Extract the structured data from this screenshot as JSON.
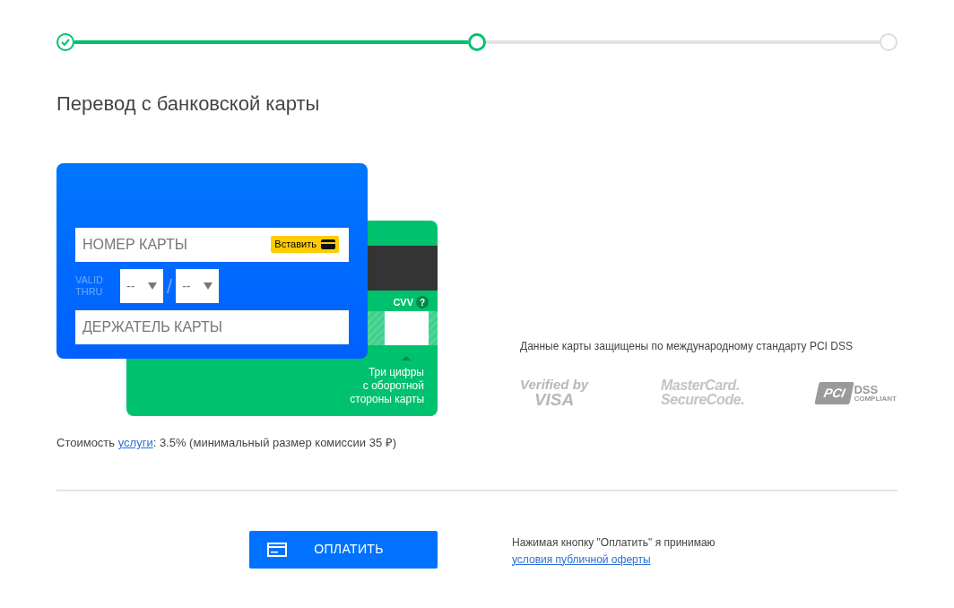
{
  "steps": [
    {
      "done": true,
      "selected": false
    },
    {
      "done": false,
      "selected": true
    },
    {
      "done": false,
      "selected": false
    }
  ],
  "title": "Перевод с банковской карты",
  "card_front": {
    "number_placeholder": "НОМЕР КАРТЫ",
    "paste_button": "Вставить",
    "valid_thru": "VALID THRU",
    "month": "--",
    "separator": "/",
    "year": "--",
    "holder_placeholder": "ДЕРЖАТЕЛЬ КАРТЫ"
  },
  "card_back": {
    "cvv_label": "CVV",
    "help": "?",
    "hint_lines": [
      "Три цифры",
      "с оборотной",
      "стороны карты"
    ]
  },
  "fee": {
    "before": "Стоимость ",
    "link": "услуги",
    "after": ": 3.5% (минимальный размер комиссии 35 ₽)"
  },
  "security": {
    "note": "Данные карты защищены по международному стандарту PCI DSS",
    "logos": [
      {
        "kind": "visa",
        "lines": [
          "Verified by",
          "VISA"
        ]
      },
      {
        "kind": "mastercard",
        "lines": [
          "MasterCard.",
          "SecureCode."
        ]
      },
      {
        "kind": "pci",
        "lines": [
          "PCI",
          "DSS",
          "COMPLIANT"
        ]
      }
    ]
  },
  "pay_button": "ОПЛАТИТЬ",
  "terms": {
    "text": "Нажимая кнопку \"Оплатить\" я принимаю",
    "link": "условия публичной оферты"
  }
}
